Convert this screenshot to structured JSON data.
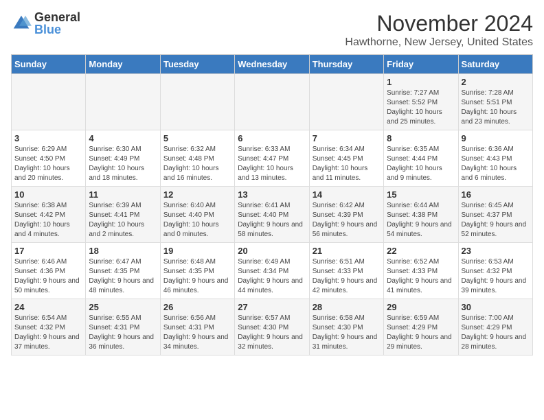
{
  "logo": {
    "general": "General",
    "blue": "Blue"
  },
  "title": "November 2024",
  "location": "Hawthorne, New Jersey, United States",
  "days_of_week": [
    "Sunday",
    "Monday",
    "Tuesday",
    "Wednesday",
    "Thursday",
    "Friday",
    "Saturday"
  ],
  "weeks": [
    [
      {
        "day": "",
        "info": ""
      },
      {
        "day": "",
        "info": ""
      },
      {
        "day": "",
        "info": ""
      },
      {
        "day": "",
        "info": ""
      },
      {
        "day": "",
        "info": ""
      },
      {
        "day": "1",
        "info": "Sunrise: 7:27 AM\nSunset: 5:52 PM\nDaylight: 10 hours and 25 minutes."
      },
      {
        "day": "2",
        "info": "Sunrise: 7:28 AM\nSunset: 5:51 PM\nDaylight: 10 hours and 23 minutes."
      }
    ],
    [
      {
        "day": "3",
        "info": "Sunrise: 6:29 AM\nSunset: 4:50 PM\nDaylight: 10 hours and 20 minutes."
      },
      {
        "day": "4",
        "info": "Sunrise: 6:30 AM\nSunset: 4:49 PM\nDaylight: 10 hours and 18 minutes."
      },
      {
        "day": "5",
        "info": "Sunrise: 6:32 AM\nSunset: 4:48 PM\nDaylight: 10 hours and 16 minutes."
      },
      {
        "day": "6",
        "info": "Sunrise: 6:33 AM\nSunset: 4:47 PM\nDaylight: 10 hours and 13 minutes."
      },
      {
        "day": "7",
        "info": "Sunrise: 6:34 AM\nSunset: 4:45 PM\nDaylight: 10 hours and 11 minutes."
      },
      {
        "day": "8",
        "info": "Sunrise: 6:35 AM\nSunset: 4:44 PM\nDaylight: 10 hours and 9 minutes."
      },
      {
        "day": "9",
        "info": "Sunrise: 6:36 AM\nSunset: 4:43 PM\nDaylight: 10 hours and 6 minutes."
      }
    ],
    [
      {
        "day": "10",
        "info": "Sunrise: 6:38 AM\nSunset: 4:42 PM\nDaylight: 10 hours and 4 minutes."
      },
      {
        "day": "11",
        "info": "Sunrise: 6:39 AM\nSunset: 4:41 PM\nDaylight: 10 hours and 2 minutes."
      },
      {
        "day": "12",
        "info": "Sunrise: 6:40 AM\nSunset: 4:40 PM\nDaylight: 10 hours and 0 minutes."
      },
      {
        "day": "13",
        "info": "Sunrise: 6:41 AM\nSunset: 4:40 PM\nDaylight: 9 hours and 58 minutes."
      },
      {
        "day": "14",
        "info": "Sunrise: 6:42 AM\nSunset: 4:39 PM\nDaylight: 9 hours and 56 minutes."
      },
      {
        "day": "15",
        "info": "Sunrise: 6:44 AM\nSunset: 4:38 PM\nDaylight: 9 hours and 54 minutes."
      },
      {
        "day": "16",
        "info": "Sunrise: 6:45 AM\nSunset: 4:37 PM\nDaylight: 9 hours and 52 minutes."
      }
    ],
    [
      {
        "day": "17",
        "info": "Sunrise: 6:46 AM\nSunset: 4:36 PM\nDaylight: 9 hours and 50 minutes."
      },
      {
        "day": "18",
        "info": "Sunrise: 6:47 AM\nSunset: 4:35 PM\nDaylight: 9 hours and 48 minutes."
      },
      {
        "day": "19",
        "info": "Sunrise: 6:48 AM\nSunset: 4:35 PM\nDaylight: 9 hours and 46 minutes."
      },
      {
        "day": "20",
        "info": "Sunrise: 6:49 AM\nSunset: 4:34 PM\nDaylight: 9 hours and 44 minutes."
      },
      {
        "day": "21",
        "info": "Sunrise: 6:51 AM\nSunset: 4:33 PM\nDaylight: 9 hours and 42 minutes."
      },
      {
        "day": "22",
        "info": "Sunrise: 6:52 AM\nSunset: 4:33 PM\nDaylight: 9 hours and 41 minutes."
      },
      {
        "day": "23",
        "info": "Sunrise: 6:53 AM\nSunset: 4:32 PM\nDaylight: 9 hours and 39 minutes."
      }
    ],
    [
      {
        "day": "24",
        "info": "Sunrise: 6:54 AM\nSunset: 4:32 PM\nDaylight: 9 hours and 37 minutes."
      },
      {
        "day": "25",
        "info": "Sunrise: 6:55 AM\nSunset: 4:31 PM\nDaylight: 9 hours and 36 minutes."
      },
      {
        "day": "26",
        "info": "Sunrise: 6:56 AM\nSunset: 4:31 PM\nDaylight: 9 hours and 34 minutes."
      },
      {
        "day": "27",
        "info": "Sunrise: 6:57 AM\nSunset: 4:30 PM\nDaylight: 9 hours and 32 minutes."
      },
      {
        "day": "28",
        "info": "Sunrise: 6:58 AM\nSunset: 4:30 PM\nDaylight: 9 hours and 31 minutes."
      },
      {
        "day": "29",
        "info": "Sunrise: 6:59 AM\nSunset: 4:29 PM\nDaylight: 9 hours and 29 minutes."
      },
      {
        "day": "30",
        "info": "Sunrise: 7:00 AM\nSunset: 4:29 PM\nDaylight: 9 hours and 28 minutes."
      }
    ]
  ]
}
